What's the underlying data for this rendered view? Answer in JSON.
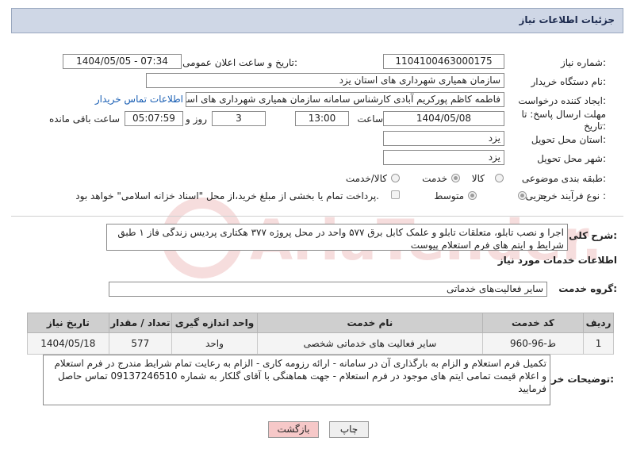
{
  "header": {
    "title": "جزئیات اطلاعات نیاز"
  },
  "fields": {
    "need_number_label": "شماره نیاز:",
    "need_number": "1104100463000175",
    "announce_label": "تاریخ و ساعت اعلان عمومی:",
    "announce_value": "1404/05/05 - 07:34",
    "buyer_org_label": "نام دستگاه خریدار:",
    "buyer_org": "سازمان همیاری شهرداری های استان یزد",
    "requester_label": "ایجاد کننده درخواست:",
    "requester": "فاطمه کاظم پورکریم آبادی کارشناس سامانه سازمان همیاری شهرداری های استان",
    "contact_link": "اطلاعات تماس خریدار",
    "deadline_label_1": "مهلت ارسال پاسخ: تا",
    "deadline_label_2": "تاریخ:",
    "deadline_date": "1404/05/08",
    "time_label": "ساعت",
    "deadline_time": "13:00",
    "days_value": "3",
    "days_label": "روز و",
    "remaining_time": "05:07:59",
    "remaining_label": "ساعت باقی مانده",
    "province_label": "استان محل تحویل:",
    "province": "یزد",
    "city_label": "شهر محل تحویل:",
    "city": "یزد",
    "category_label": "طبقه بندی موضوعی:",
    "category_options": [
      "کالا",
      "خدمت",
      "کالا/خدمت"
    ],
    "category_selected": "خدمت",
    "process_label": "نوع فرآیند خرید :",
    "process_options": [
      "جزیی",
      "متوسط"
    ],
    "process_selected": "جزیی",
    "payment_note": "پرداخت تمام یا بخشی از مبلغ خرید،از محل \"اسناد خزانه اسلامی\" خواهد بود."
  },
  "description": {
    "label": "شرح کلی نیاز:",
    "text": "اجرا و نصب تابلو، متعلقات تابلو و علمک کابل برق ۵۷۷ واحد در محل پروژه ۳۷۷ هکتاری پردیس زندگی فاز ۱ طبق شرایط و ایتم های فرم استعلام پیوست"
  },
  "services": {
    "section_title": "اطلاعات خدمات مورد نیاز",
    "group_label": "گروه خدمت:",
    "group_value": "سایر فعالیت‌های خدماتی",
    "columns": [
      "ردیف",
      "کد خدمت",
      "نام خدمت",
      "واحد اندازه گیری",
      "تعداد / مقدار",
      "تاریخ نیاز"
    ],
    "rows": [
      {
        "row": "1",
        "code": "ط-96-960",
        "name": "سایر فعالیت های خدماتی شخصی",
        "unit": "واحد",
        "qty": "577",
        "date": "1404/05/18"
      }
    ]
  },
  "notes": {
    "label": "توضیحات خریدار:",
    "text": "تکمیل فرم استعلام و الزام به بارگذاری آن در سامانه - ارائه رزومه کاری - الزام به رعایت تمام شرایط مندرج در فرم استعلام و اعلام قیمت تمامی ایتم های موجود در فرم استعلام - جهت هماهنگی با آقای گلکار به شماره 09137246510 تماس حاصل فرمایید"
  },
  "buttons": {
    "print": "چاپ",
    "back": "بازگشت"
  },
  "colors": {
    "header_bg": "#cfd7e6",
    "link": "#1a5fb4",
    "back_button": "#f6c8c8"
  }
}
